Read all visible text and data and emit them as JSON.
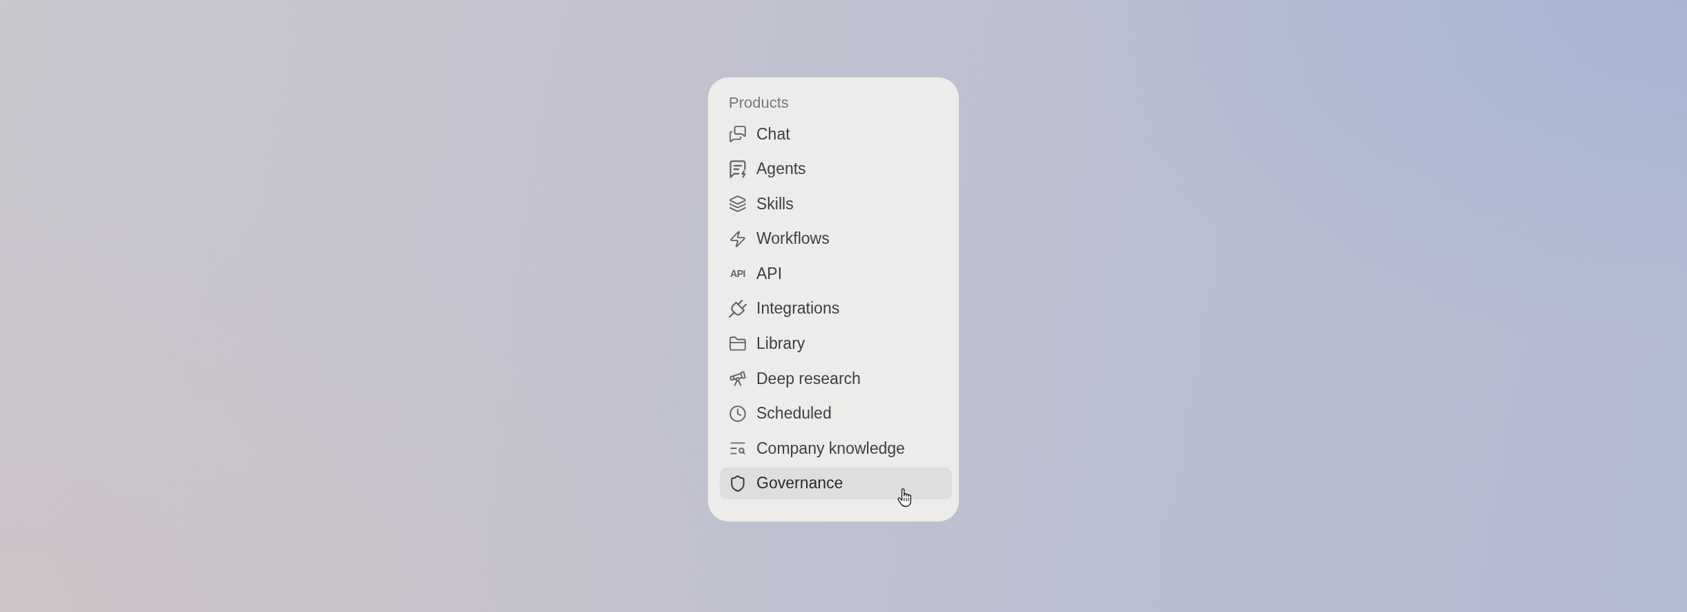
{
  "menu": {
    "heading": "Products",
    "items": [
      {
        "label": "Chat",
        "selected": false
      },
      {
        "label": "Agents",
        "selected": false
      },
      {
        "label": "Skills",
        "selected": false
      },
      {
        "label": "Workflows",
        "selected": false
      },
      {
        "label": "API",
        "icon_text": "API",
        "selected": false
      },
      {
        "label": "Integrations",
        "selected": false
      },
      {
        "label": "Library",
        "selected": false
      },
      {
        "label": "Deep research",
        "selected": false
      },
      {
        "label": "Scheduled",
        "selected": false
      },
      {
        "label": "Company knowledge",
        "selected": false
      },
      {
        "label": "Governance",
        "selected": true
      }
    ]
  }
}
